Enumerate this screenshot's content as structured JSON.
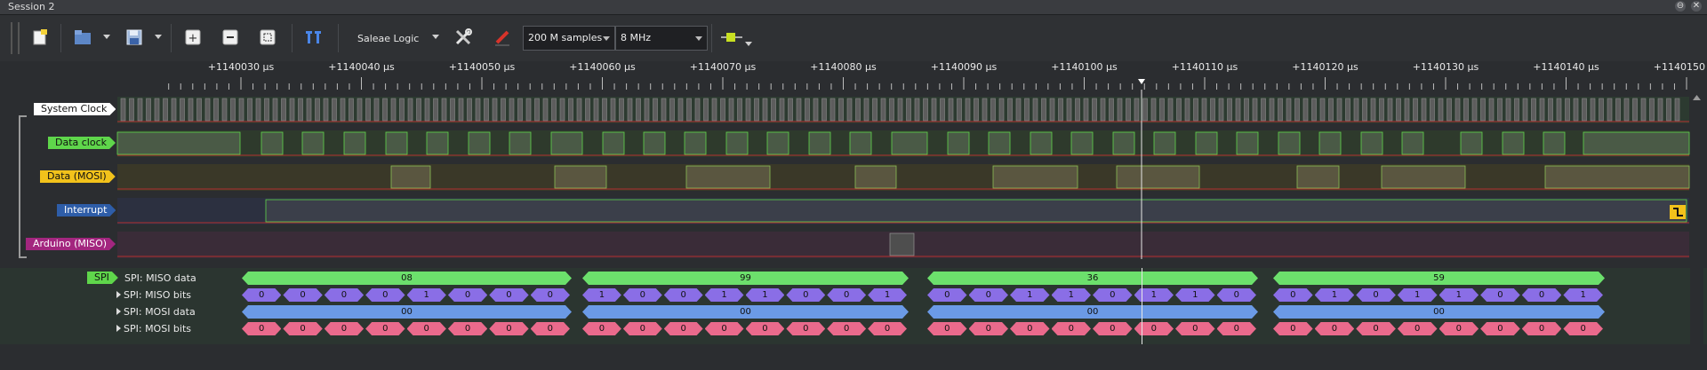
{
  "window": {
    "title": "Session 2",
    "min_icon": "restore-icon",
    "close_icon": "close-icon"
  },
  "toolbar": {
    "device": "Saleae Logic",
    "samples": "200 M samples",
    "rate": "8 MHz",
    "icons": [
      "new-session-icon",
      "open-icon",
      "save-icon",
      "zoom-in-icon",
      "zoom-out-icon",
      "zoom-fit-icon",
      "timing-marker-icon",
      "settings-wrench-icon",
      "trigger-pen-icon",
      "analyzer-plug-icon"
    ]
  },
  "ruler": {
    "ticks": [
      "+1140030 µs",
      "+1140040 µs",
      "+1140050 µs",
      "+1140060 µs",
      "+1140070 µs",
      "+1140080 µs",
      "+1140090 µs",
      "+1140100 µs",
      "+1140110 µs",
      "+1140120 µs",
      "+1140130 µs",
      "+1140140 µs",
      "+1140150 µs"
    ]
  },
  "channels": [
    {
      "name": "System Clock",
      "color": "#ffffff",
      "text_color": "#111111"
    },
    {
      "name": "Data clock",
      "color": "#5fd64b",
      "text_color": "#111111"
    },
    {
      "name": "Data (MOSI)",
      "color": "#f2c21b",
      "text_color": "#111111"
    },
    {
      "name": "Interrupt",
      "color": "#2e5da8",
      "text_color": "#ffffff"
    },
    {
      "name": "Arduino (MISO)",
      "color": "#a3267f",
      "text_color": "#ffffff"
    }
  ],
  "analyzer": {
    "name": "SPI",
    "rows": [
      {
        "label": "SPI: MISO data",
        "expandable": false,
        "color": "#6ce06c",
        "values": [
          "08",
          "99",
          "36",
          "59"
        ]
      },
      {
        "label": "SPI: MISO bits",
        "expandable": true,
        "color": "#8a6ee6",
        "values": [
          [
            "0",
            "0",
            "0",
            "0",
            "1",
            "0",
            "0",
            "0"
          ],
          [
            "1",
            "0",
            "0",
            "1",
            "1",
            "0",
            "0",
            "1"
          ],
          [
            "0",
            "0",
            "1",
            "1",
            "0",
            "1",
            "1",
            "0"
          ],
          [
            "0",
            "1",
            "0",
            "1",
            "1",
            "0",
            "0",
            "1"
          ]
        ]
      },
      {
        "label": "SPI: MOSI data",
        "expandable": true,
        "color": "#6b9ae6",
        "values": [
          "00",
          "00",
          "00",
          "00"
        ]
      },
      {
        "label": "SPI: MOSI bits",
        "expandable": true,
        "color": "#ea6a8c",
        "values": [
          [
            "0",
            "0",
            "0",
            "0",
            "0",
            "0",
            "0",
            "0"
          ],
          [
            "0",
            "0",
            "0",
            "0",
            "0",
            "0",
            "0",
            "0"
          ],
          [
            "0",
            "0",
            "0",
            "0",
            "0",
            "0",
            "0",
            "0"
          ],
          [
            "0",
            "0",
            "0",
            "0",
            "0",
            "0",
            "0",
            "0"
          ]
        ]
      }
    ]
  },
  "colors": {
    "accent": "#5fd64b",
    "cursor": "#ffffff",
    "trigger_badge": "#f2c21b"
  }
}
